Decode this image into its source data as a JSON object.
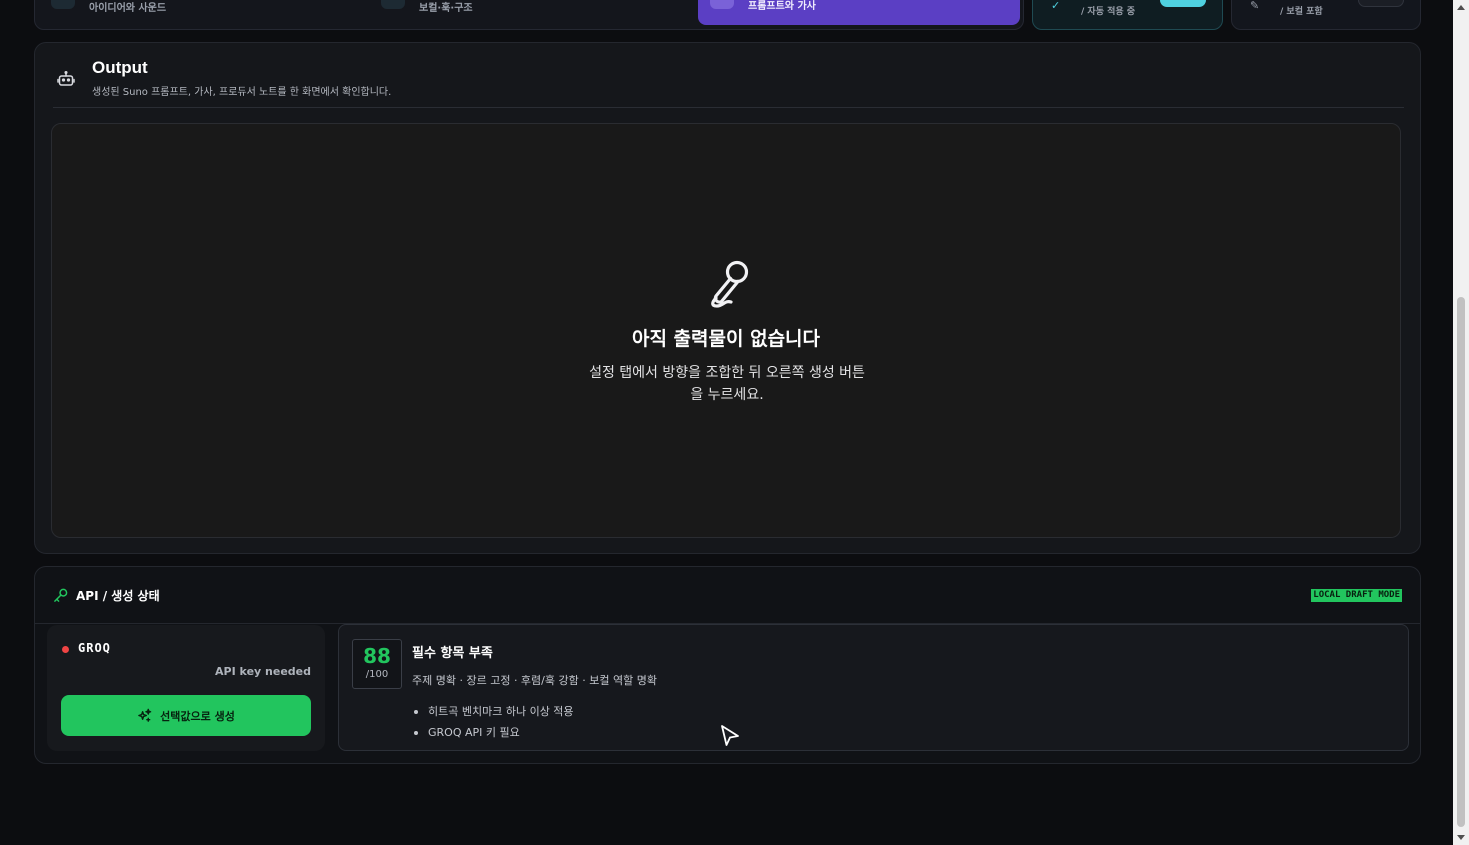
{
  "steps": [
    {
      "label": "아이디어와 사운드"
    },
    {
      "label": "보컬·훅·구조"
    },
    {
      "label": "프롬프트와 가사",
      "active": true
    }
  ],
  "toggles": [
    {
      "label": "/ 자동 적용 중",
      "icon": "check-icon",
      "on": true
    },
    {
      "label": "/ 보컬 포함",
      "icon": "pen-icon",
      "on": false
    }
  ],
  "output": {
    "title": "Output",
    "subtitle": "생성된 Suno 프롬프트, 가사, 프로듀서 노트를 한 화면에서 확인합니다.",
    "empty_title": "아직 출력물이 없습니다",
    "empty_desc": "설정 탭에서 방향을 조합한 뒤 오른쪽 생성 버튼을 누르세요."
  },
  "api": {
    "title": "API / 생성 상태",
    "mode_badge": "LOCAL DRAFT MODE",
    "provider": {
      "name": "GROQ",
      "status": "API key needed",
      "status_color": "#ef4444"
    },
    "generate_label": "선택값으로 생성",
    "score": {
      "value": "88",
      "max": "/100",
      "title": "필수 항목 부족",
      "desc": "주제 명확 · 장르 고정 · 후렴/훅 강함 · 보컬 역할 명확",
      "items": [
        "히트곡 벤치마크 하나 이상 적용",
        "GROQ API 키 필요"
      ]
    }
  },
  "colors": {
    "accent_green": "#22c55e",
    "accent_purple": "#5b3fc4",
    "accent_cyan": "#4fd1e0",
    "background": "#0c0d10"
  }
}
